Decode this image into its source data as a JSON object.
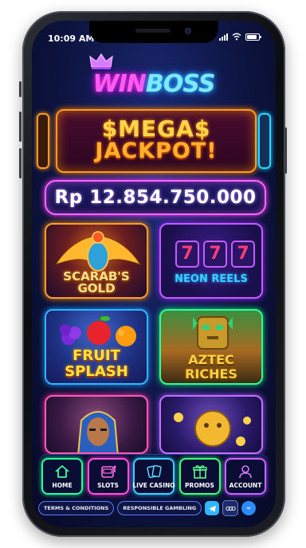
{
  "status": {
    "time": "10:09 AM"
  },
  "brand": {
    "part1": "WIN",
    "part2": "BOSS"
  },
  "banner": {
    "line1": "$MEGA$",
    "line2": "JACKPOT!"
  },
  "jackpot": {
    "amount": "Rp 12.854.750.000"
  },
  "games": [
    {
      "title_line1": "SCARAB'S",
      "title_line2": "GOLD",
      "color": "#ffd36a"
    },
    {
      "title_line1": "777",
      "title_line2": "NEON REELS",
      "color": "#32c8ff"
    },
    {
      "title_line1": "FRUIT",
      "title_line2": "SPLASH",
      "color": "#ffe03a"
    },
    {
      "title_line1": "AZTEC",
      "title_line2": "RICHES",
      "color": "#ffd045"
    },
    {
      "title_line1": "",
      "title_line2": "",
      "color": "#ffb74a"
    },
    {
      "title_line1": "",
      "title_line2": "",
      "color": "#ffcf4a"
    }
  ],
  "nav": {
    "home": "HOME",
    "slots": "SLOTS",
    "live": "LIVE CASINO",
    "promos": "PROMOS",
    "account": "ACCOUNT"
  },
  "footer": {
    "terms": "TERMS & CONDITIONS",
    "responsible": "RESPONSIBLE GAMBLING"
  },
  "icons": [
    "home-icon",
    "slot-machine-icon",
    "cards-icon",
    "gift-icon",
    "user-icon",
    "telegram-icon",
    "chat-icon",
    "messenger-icon"
  ]
}
